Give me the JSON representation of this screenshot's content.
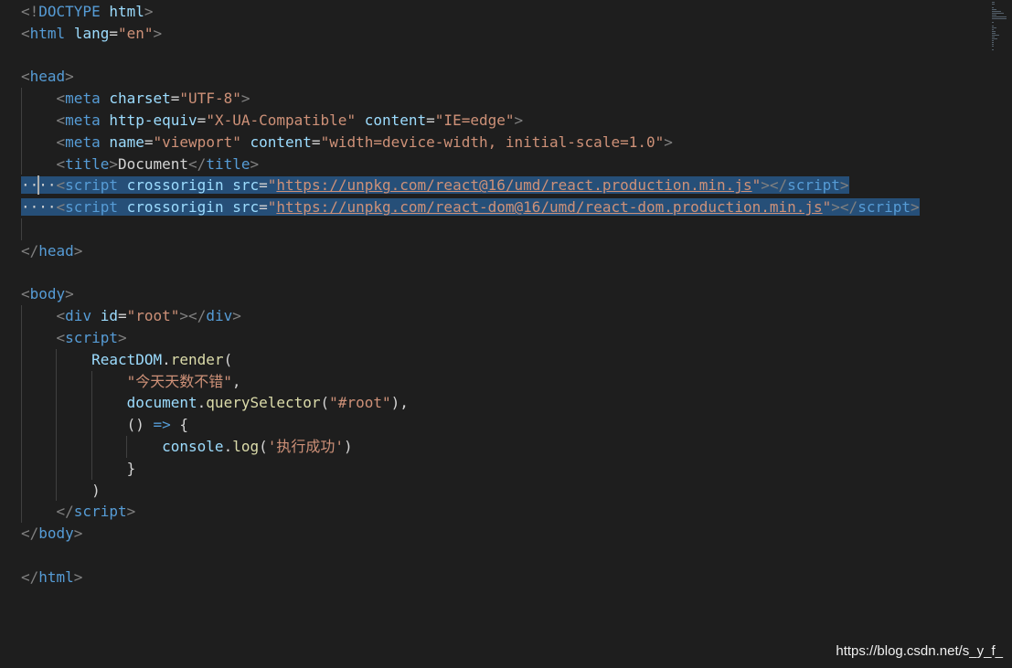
{
  "editor": {
    "lines": [
      [
        {
          "t": "<!",
          "c": "punc"
        },
        {
          "t": "DOCTYPE",
          "c": "tag"
        },
        {
          "t": " html",
          "c": "attr"
        },
        {
          "t": ">",
          "c": "punc"
        }
      ],
      [
        {
          "t": "<",
          "c": "punc"
        },
        {
          "t": "html",
          "c": "tag"
        },
        {
          "t": " ",
          "c": "text"
        },
        {
          "t": "lang",
          "c": "attr"
        },
        {
          "t": "=",
          "c": "text"
        },
        {
          "t": "\"en\"",
          "c": "str"
        },
        {
          "t": ">",
          "c": "punc"
        }
      ],
      [],
      [
        {
          "t": "<",
          "c": "punc"
        },
        {
          "t": "head",
          "c": "tag"
        },
        {
          "t": ">",
          "c": "punc"
        }
      ],
      [
        {
          "t": "    ",
          "c": "text"
        },
        {
          "t": "<",
          "c": "punc"
        },
        {
          "t": "meta",
          "c": "tag"
        },
        {
          "t": " ",
          "c": "text"
        },
        {
          "t": "charset",
          "c": "attr"
        },
        {
          "t": "=",
          "c": "text"
        },
        {
          "t": "\"UTF-8\"",
          "c": "str"
        },
        {
          "t": ">",
          "c": "punc"
        }
      ],
      [
        {
          "t": "    ",
          "c": "text"
        },
        {
          "t": "<",
          "c": "punc"
        },
        {
          "t": "meta",
          "c": "tag"
        },
        {
          "t": " ",
          "c": "text"
        },
        {
          "t": "http-equiv",
          "c": "attr"
        },
        {
          "t": "=",
          "c": "text"
        },
        {
          "t": "\"X-UA-Compatible\"",
          "c": "str"
        },
        {
          "t": " ",
          "c": "text"
        },
        {
          "t": "content",
          "c": "attr"
        },
        {
          "t": "=",
          "c": "text"
        },
        {
          "t": "\"IE=edge\"",
          "c": "str"
        },
        {
          "t": ">",
          "c": "punc"
        }
      ],
      [
        {
          "t": "    ",
          "c": "text"
        },
        {
          "t": "<",
          "c": "punc"
        },
        {
          "t": "meta",
          "c": "tag"
        },
        {
          "t": " ",
          "c": "text"
        },
        {
          "t": "name",
          "c": "attr"
        },
        {
          "t": "=",
          "c": "text"
        },
        {
          "t": "\"viewport\"",
          "c": "str"
        },
        {
          "t": " ",
          "c": "text"
        },
        {
          "t": "content",
          "c": "attr"
        },
        {
          "t": "=",
          "c": "text"
        },
        {
          "t": "\"width=device-width, initial-scale=1.0\"",
          "c": "str"
        },
        {
          "t": ">",
          "c": "punc"
        }
      ],
      [
        {
          "t": "    ",
          "c": "text"
        },
        {
          "t": "<",
          "c": "punc"
        },
        {
          "t": "title",
          "c": "tag"
        },
        {
          "t": ">",
          "c": "punc"
        },
        {
          "t": "Document",
          "c": "text"
        },
        {
          "t": "</",
          "c": "punc"
        },
        {
          "t": "title",
          "c": "tag"
        },
        {
          "t": ">",
          "c": "punc"
        }
      ],
      [
        {
          "t": "····",
          "c": "ws"
        },
        {
          "t": "<",
          "c": "punc"
        },
        {
          "t": "script",
          "c": "tag"
        },
        {
          "t": " ",
          "c": "text"
        },
        {
          "t": "crossorigin",
          "c": "attr"
        },
        {
          "t": " ",
          "c": "text"
        },
        {
          "t": "src",
          "c": "attr"
        },
        {
          "t": "=",
          "c": "text"
        },
        {
          "t": "\"",
          "c": "str"
        },
        {
          "t": "https://unpkg.com/react@16/umd/react.production.min.js",
          "c": "url"
        },
        {
          "t": "\"",
          "c": "str"
        },
        {
          "t": "></",
          "c": "punc"
        },
        {
          "t": "script",
          "c": "tag"
        },
        {
          "t": ">",
          "c": "punc"
        }
      ],
      [
        {
          "t": "····",
          "c": "ws"
        },
        {
          "t": "<",
          "c": "punc"
        },
        {
          "t": "script",
          "c": "tag"
        },
        {
          "t": " ",
          "c": "text"
        },
        {
          "t": "crossorigin",
          "c": "attr"
        },
        {
          "t": " ",
          "c": "text"
        },
        {
          "t": "src",
          "c": "attr"
        },
        {
          "t": "=",
          "c": "text"
        },
        {
          "t": "\"",
          "c": "str"
        },
        {
          "t": "https://unpkg.com/react-dom@16/umd/react-dom.production.min.js",
          "c": "url"
        },
        {
          "t": "\"",
          "c": "str"
        },
        {
          "t": "></",
          "c": "punc"
        },
        {
          "t": "script",
          "c": "tag"
        },
        {
          "t": ">",
          "c": "punc"
        }
      ],
      [],
      [
        {
          "t": "</",
          "c": "punc"
        },
        {
          "t": "head",
          "c": "tag"
        },
        {
          "t": ">",
          "c": "punc"
        }
      ],
      [],
      [
        {
          "t": "<",
          "c": "punc"
        },
        {
          "t": "body",
          "c": "tag"
        },
        {
          "t": ">",
          "c": "punc"
        }
      ],
      [
        {
          "t": "    ",
          "c": "text"
        },
        {
          "t": "<",
          "c": "punc"
        },
        {
          "t": "div",
          "c": "tag"
        },
        {
          "t": " ",
          "c": "text"
        },
        {
          "t": "id",
          "c": "attr"
        },
        {
          "t": "=",
          "c": "text"
        },
        {
          "t": "\"root\"",
          "c": "str"
        },
        {
          "t": "></",
          "c": "punc"
        },
        {
          "t": "div",
          "c": "tag"
        },
        {
          "t": ">",
          "c": "punc"
        }
      ],
      [
        {
          "t": "    ",
          "c": "text"
        },
        {
          "t": "<",
          "c": "punc"
        },
        {
          "t": "script",
          "c": "tag"
        },
        {
          "t": ">",
          "c": "punc"
        }
      ],
      [
        {
          "t": "        ",
          "c": "text"
        },
        {
          "t": "ReactDOM",
          "c": "var"
        },
        {
          "t": ".",
          "c": "text"
        },
        {
          "t": "render",
          "c": "fn"
        },
        {
          "t": "(",
          "c": "text"
        }
      ],
      [
        {
          "t": "            ",
          "c": "text"
        },
        {
          "t": "\"今天天数不错\"",
          "c": "str"
        },
        {
          "t": ",",
          "c": "text"
        }
      ],
      [
        {
          "t": "            ",
          "c": "text"
        },
        {
          "t": "document",
          "c": "var"
        },
        {
          "t": ".",
          "c": "text"
        },
        {
          "t": "querySelector",
          "c": "fn"
        },
        {
          "t": "(",
          "c": "text"
        },
        {
          "t": "\"#root\"",
          "c": "str"
        },
        {
          "t": "),",
          "c": "text"
        }
      ],
      [
        {
          "t": "            ",
          "c": "text"
        },
        {
          "t": "() ",
          "c": "text"
        },
        {
          "t": "=>",
          "c": "arrow"
        },
        {
          "t": " {",
          "c": "text"
        }
      ],
      [
        {
          "t": "                ",
          "c": "text"
        },
        {
          "t": "console",
          "c": "var"
        },
        {
          "t": ".",
          "c": "text"
        },
        {
          "t": "log",
          "c": "fn"
        },
        {
          "t": "(",
          "c": "text"
        },
        {
          "t": "'执行成功'",
          "c": "str"
        },
        {
          "t": ")",
          "c": "text"
        }
      ],
      [
        {
          "t": "            ",
          "c": "text"
        },
        {
          "t": "}",
          "c": "text"
        }
      ],
      [
        {
          "t": "        ",
          "c": "text"
        },
        {
          "t": ")",
          "c": "text"
        }
      ],
      [
        {
          "t": "    ",
          "c": "text"
        },
        {
          "t": "</",
          "c": "punc"
        },
        {
          "t": "script",
          "c": "tag"
        },
        {
          "t": ">",
          "c": "punc"
        }
      ],
      [
        {
          "t": "</",
          "c": "punc"
        },
        {
          "t": "body",
          "c": "tag"
        },
        {
          "t": ">",
          "c": "punc"
        }
      ],
      [],
      [
        {
          "t": "</",
          "c": "punc"
        },
        {
          "t": "html",
          "c": "tag"
        },
        {
          "t": ">",
          "c": "punc"
        }
      ]
    ],
    "selected_lines": [
      8,
      9
    ],
    "cursor_line": 8,
    "colors": {
      "background": "#1e1e1e",
      "selection": "#264f78",
      "tag": "#569cd6",
      "attribute": "#9cdcfe",
      "string": "#ce9178",
      "punctuation": "#808080",
      "function": "#dcdcaa"
    }
  },
  "watermark": {
    "text": "https://blog.csdn.net/s_y_f_"
  }
}
